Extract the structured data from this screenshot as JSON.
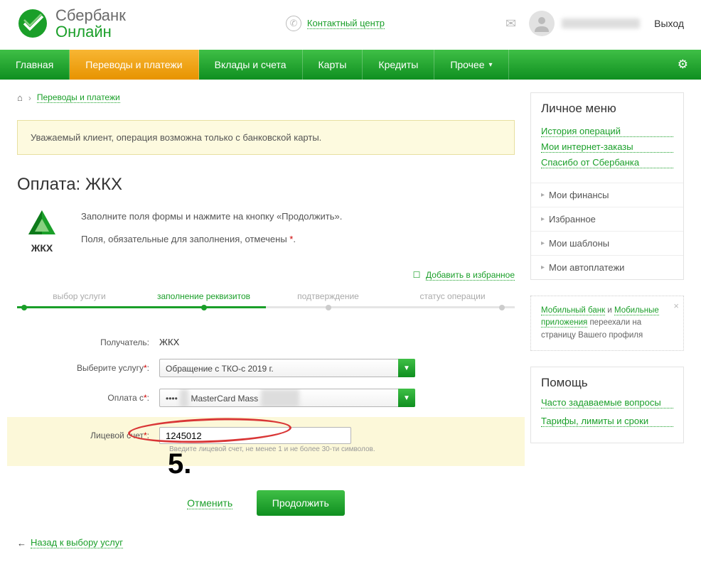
{
  "header": {
    "logo_top": "Сбербанк",
    "logo_bottom": "Онлайн",
    "contact_label": "Контактный центр",
    "logout": "Выход"
  },
  "nav": {
    "items": [
      {
        "label": "Главная"
      },
      {
        "label": "Переводы и платежи"
      },
      {
        "label": "Вклады и счета"
      },
      {
        "label": "Карты"
      },
      {
        "label": "Кредиты"
      },
      {
        "label": "Прочее"
      }
    ]
  },
  "breadcrumb": {
    "link": "Переводы и платежи"
  },
  "notice": "Уважаемый клиент, операция возможна только с банковской карты.",
  "page_title": "Оплата: ЖКХ",
  "provider_code": "ЖКХ",
  "intro_line1": "Заполните поля формы и нажмите на кнопку «Продолжить».",
  "intro_line2_a": "Поля, обязательные для заполнения, отмечены ",
  "intro_line2_b": ".",
  "favorite": "Добавить в избранное",
  "steps": [
    "выбор услуги",
    "заполнение реквизитов",
    "подтверждение",
    "статус операции"
  ],
  "form": {
    "recipient_label": "Получатель:",
    "recipient_value": "ЖКХ",
    "service_label": "Выберите услугу",
    "service_value": "Обращение с ТКО-с 2019 г.",
    "payfrom_label": "Оплата с",
    "payfrom_value_prefix": "•••• ",
    "payfrom_card": "MasterCard Mass",
    "account_label": "Лицевой счет",
    "account_value": "1245012",
    "account_hint": "Введите лицевой счет, не менее 1 и не более 30-ти символов."
  },
  "step_number": "5.",
  "actions": {
    "cancel": "Отменить",
    "continue": "Продолжить"
  },
  "back_link": "Назад к выбору услуг",
  "sidebar": {
    "menu_title": "Личное меню",
    "links": [
      "История операций",
      "Мои интернет-заказы",
      "Спасибо от Сбербанка"
    ],
    "nav": [
      "Мои финансы",
      "Избранное",
      "Мои шаблоны",
      "Мои автоплатежи"
    ],
    "info_a": "Мобильный банк",
    "info_and": " и ",
    "info_b": "Мобильные приложения",
    "info_rest": " переехали на страницу Вашего профиля",
    "help_title": "Помощь",
    "help_links": [
      "Часто задаваемые вопросы",
      "Тарифы, лимиты и сроки"
    ]
  }
}
